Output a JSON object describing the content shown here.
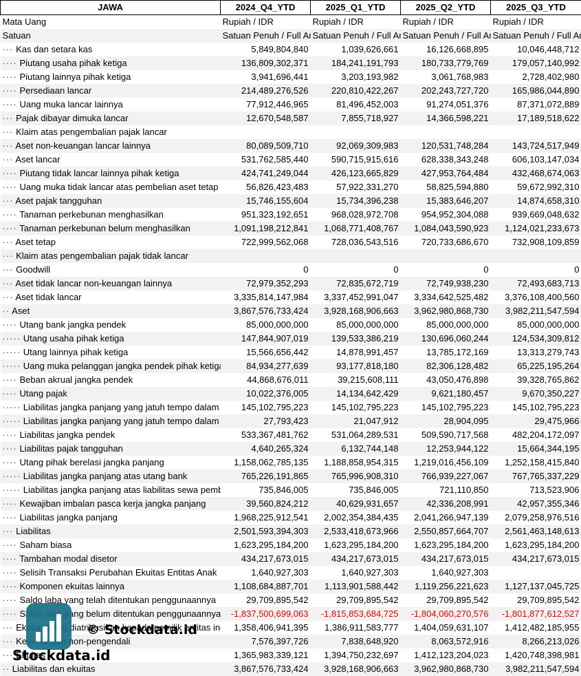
{
  "header": {
    "label": "JAWA",
    "periods": [
      "2024_Q4_YTD",
      "2025_Q1_YTD",
      "2025_Q2_YTD",
      "2025_Q3_YTD"
    ]
  },
  "rows": [
    {
      "dots": "",
      "label": "Mata Uang",
      "values": [
        "Rupiah / IDR",
        "Rupiah / IDR",
        "Rupiah / IDR",
        "Rupiah / IDR"
      ],
      "text": true
    },
    {
      "dots": "",
      "label": "Satuan",
      "values": [
        "Satuan Penuh / Full Amount",
        "Satuan Penuh / Full Amount",
        "Satuan Penuh / Full Amount",
        "Satuan Penuh / Full Amount"
      ],
      "text": true
    },
    {
      "dots": "···",
      "label": "Kas dan setara kas",
      "values": [
        "5,849,804,840",
        "1,039,626,661",
        "16,126,668,895",
        "10,046,448,712"
      ]
    },
    {
      "dots": "····",
      "label": "Piutang usaha pihak ketiga",
      "values": [
        "136,809,302,371",
        "184,241,191,793",
        "180,733,779,769",
        "179,057,140,992"
      ]
    },
    {
      "dots": "····",
      "label": "Piutang lainnya pihak ketiga",
      "values": [
        "3,941,696,441",
        "3,203,193,982",
        "3,061,768,983",
        "2,728,402,980"
      ]
    },
    {
      "dots": "····",
      "label": "Persediaan lancar",
      "values": [
        "214,489,276,526",
        "220,810,422,267",
        "202,243,727,720",
        "165,986,044,890"
      ]
    },
    {
      "dots": "····",
      "label": "Uang muka lancar lainnya",
      "values": [
        "77,912,446,965",
        "81,496,452,003",
        "91,274,051,376",
        "87,371,072,889"
      ]
    },
    {
      "dots": "···",
      "label": "Pajak dibayar dimuka lancar",
      "values": [
        "12,670,548,587",
        "7,855,718,927",
        "14,366,598,221",
        "17,189,518,622"
      ]
    },
    {
      "dots": "···",
      "label": "Klaim atas pengembalian pajak lancar",
      "values": [
        "",
        "",
        "",
        ""
      ]
    },
    {
      "dots": "···",
      "label": "Aset non-keuangan lancar lainnya",
      "values": [
        "80,089,509,710",
        "92,069,309,983",
        "120,531,748,284",
        "143,724,517,949"
      ]
    },
    {
      "dots": "···",
      "label": "Aset lancar",
      "values": [
        "531,762,585,440",
        "590,715,915,616",
        "628,338,343,248",
        "606,103,147,034"
      ]
    },
    {
      "dots": "····",
      "label": "Piutang tidak lancar lainnya pihak ketiga",
      "values": [
        "424,741,249,044",
        "426,123,665,829",
        "427,953,764,484",
        "432,468,674,063"
      ]
    },
    {
      "dots": "····",
      "label": "Uang muka tidak lancar atas pembelian aset tetap",
      "values": [
        "56,826,423,483",
        "57,922,331,270",
        "58,825,594,880",
        "59,672,992,310"
      ]
    },
    {
      "dots": "···",
      "label": "Aset pajak tangguhan",
      "values": [
        "15,746,155,604",
        "15,734,396,238",
        "15,383,646,207",
        "14,874,658,310"
      ]
    },
    {
      "dots": "····",
      "label": "Tanaman perkebunan menghasilkan",
      "values": [
        "951,323,192,651",
        "968,028,972,708",
        "954,952,304,088",
        "939,669,048,632"
      ]
    },
    {
      "dots": "····",
      "label": "Tanaman perkebunan belum menghasilkan",
      "values": [
        "1,091,198,212,841",
        "1,068,771,408,767",
        "1,084,043,590,923",
        "1,124,021,233,673"
      ]
    },
    {
      "dots": "···",
      "label": "Aset tetap",
      "values": [
        "722,999,562,068",
        "728,036,543,516",
        "720,733,686,670",
        "732,908,109,859"
      ]
    },
    {
      "dots": "···",
      "label": "Klaim atas pengembalian pajak tidak lancar",
      "values": [
        "",
        "",
        "",
        ""
      ]
    },
    {
      "dots": "···",
      "label": "Goodwill",
      "values": [
        "0",
        "0",
        "0",
        "0"
      ]
    },
    {
      "dots": "···",
      "label": "Aset tidak lancar non-keuangan lainnya",
      "values": [
        "72,979,352,293",
        "72,835,672,719",
        "72,749,938,230",
        "72,493,683,713"
      ]
    },
    {
      "dots": "···",
      "label": "Aset tidak lancar",
      "values": [
        "3,335,814,147,984",
        "3,337,452,991,047",
        "3,334,642,525,482",
        "3,376,108,400,560"
      ]
    },
    {
      "dots": "··",
      "label": "Aset",
      "values": [
        "3,867,576,733,424",
        "3,928,168,906,663",
        "3,962,980,868,730",
        "3,982,211,547,594"
      ]
    },
    {
      "dots": "····",
      "label": "Utang bank jangka pendek",
      "values": [
        "85,000,000,000",
        "85,000,000,000",
        "85,000,000,000",
        "85,000,000,000"
      ]
    },
    {
      "dots": "·····",
      "label": "Utang usaha pihak ketiga",
      "values": [
        "147,844,907,019",
        "139,533,386,219",
        "130,696,060,244",
        "124,534,309,812"
      ]
    },
    {
      "dots": "·····",
      "label": "Utang lainnya pihak ketiga",
      "values": [
        "15,566,656,442",
        "14,878,991,457",
        "13,785,172,169",
        "13,313,279,743"
      ]
    },
    {
      "dots": "·····",
      "label": "Uang muka pelanggan jangka pendek pihak ketiga",
      "values": [
        "84,934,277,639",
        "93,177,818,180",
        "82,306,128,482",
        "65,225,195,264"
      ]
    },
    {
      "dots": "····",
      "label": "Beban akrual jangka pendek",
      "values": [
        "44,868,676,011",
        "39,215,608,111",
        "43,050,476,898",
        "39,328,765,862"
      ]
    },
    {
      "dots": "····",
      "label": "Utang pajak",
      "values": [
        "10,022,376,005",
        "14,134,642,429",
        "9,621,180,457",
        "9,670,350,227"
      ]
    },
    {
      "dots": "·····",
      "label": "Liabilitas jangka panjang yang jatuh tempo dalam satu tahun",
      "values": [
        "145,102,795,223",
        "145,102,795,223",
        "145,102,795,223",
        "145,102,795,223"
      ]
    },
    {
      "dots": "·····",
      "label": "Liabilitas jangka panjang yang jatuh tempo dalam satu tahun",
      "values": [
        "27,793,423",
        "21,047,912",
        "28,904,095",
        "29,475,966"
      ]
    },
    {
      "dots": "····",
      "label": "Liabilitas jangka pendek",
      "values": [
        "533,367,481,762",
        "531,064,289,531",
        "509,590,717,568",
        "482,204,172,097"
      ]
    },
    {
      "dots": "····",
      "label": "Liabilitas pajak tangguhan",
      "values": [
        "4,640,265,324",
        "6,132,744,148",
        "12,253,944,122",
        "15,664,344,195"
      ]
    },
    {
      "dots": "····",
      "label": "Utang pihak berelasi jangka panjang",
      "values": [
        "1,158,062,785,135",
        "1,188,858,954,315",
        "1,219,016,456,109",
        "1,252,158,415,840"
      ]
    },
    {
      "dots": "·····",
      "label": "Liabilitas jangka panjang atas utang bank",
      "values": [
        "765,226,191,865",
        "765,996,908,310",
        "766,939,227,067",
        "767,765,337,229"
      ]
    },
    {
      "dots": "·····",
      "label": "Liabilitas jangka panjang atas liabilitas sewa pembiayaan",
      "values": [
        "735,846,005",
        "735,846,005",
        "721,110,850",
        "713,523,906"
      ]
    },
    {
      "dots": "····",
      "label": "Kewajiban imbalan pasca kerja jangka panjang",
      "values": [
        "39,560,824,212",
        "40,629,931,657",
        "42,336,208,991",
        "42,957,355,346"
      ]
    },
    {
      "dots": "····",
      "label": "Liabilitas jangka panjang",
      "values": [
        "1,968,225,912,541",
        "2,002,354,384,435",
        "2,041,266,947,139",
        "2,079,258,976,516"
      ]
    },
    {
      "dots": "···",
      "label": "Liabilitas",
      "values": [
        "2,501,593,394,303",
        "2,533,418,673,966",
        "2,550,857,664,707",
        "2,561,463,148,613"
      ]
    },
    {
      "dots": "····",
      "label": "Saham biasa",
      "values": [
        "1,623,295,184,200",
        "1,623,295,184,200",
        "1,623,295,184,200",
        "1,623,295,184,200"
      ]
    },
    {
      "dots": "····",
      "label": "Tambahan modal disetor",
      "values": [
        "434,217,673,015",
        "434,217,673,015",
        "434,217,673,015",
        "434,217,673,015"
      ]
    },
    {
      "dots": "····",
      "label": "Selisih Transaksi Perubahan Ekuitas Entitas Anak",
      "values": [
        "1,640,927,303",
        "1,640,927,303",
        "1,640,927,303",
        ""
      ]
    },
    {
      "dots": "····",
      "label": "Komponen ekuitas lainnya",
      "values": [
        "1,108,684,887,701",
        "1,113,901,588,442",
        "1,119,256,221,623",
        "1,127,137,045,725"
      ]
    },
    {
      "dots": "····",
      "label": "Saldo laba yang telah ditentukan penggunaannya",
      "values": [
        "29,709,895,542",
        "29,709,895,542",
        "29,709,895,542",
        "29,709,895,542"
      ]
    },
    {
      "dots": "····",
      "label": "Saldo laba yang belum ditentukan penggunaannya",
      "values": [
        "-1,837,500,699,063",
        "-1,815,853,684,725",
        "-1,804,060,270,576",
        "-1,801,877,612,527"
      ],
      "negative": true
    },
    {
      "dots": "···",
      "label": "Ekuitas yang diatribusikan kepada pemilik entitas induk",
      "values": [
        "1,358,406,941,395",
        "1,386,911,583,777",
        "1,404,059,631,107",
        "1,412,482,185,955"
      ]
    },
    {
      "dots": "···",
      "label": "Kepentingan non-pengendali",
      "values": [
        "7,576,397,726",
        "7,838,648,920",
        "8,063,572,916",
        "8,266,213,026"
      ]
    },
    {
      "dots": "···",
      "label": "Ekuitas",
      "values": [
        "1,365,983,339,121",
        "1,394,750,232,697",
        "1,412,123,204,023",
        "1,420,748,398,981"
      ]
    },
    {
      "dots": "··",
      "label": "Liabilitas dan ekuitas",
      "values": [
        "3,867,576,733,424",
        "3,928,168,906,663",
        "3,962,980,868,730",
        "3,982,211,547,594"
      ]
    }
  ],
  "watermark": {
    "copyright": "© Stockdata.id",
    "brand": "Stockdata.id",
    "logo_color": "#1a6f86"
  }
}
